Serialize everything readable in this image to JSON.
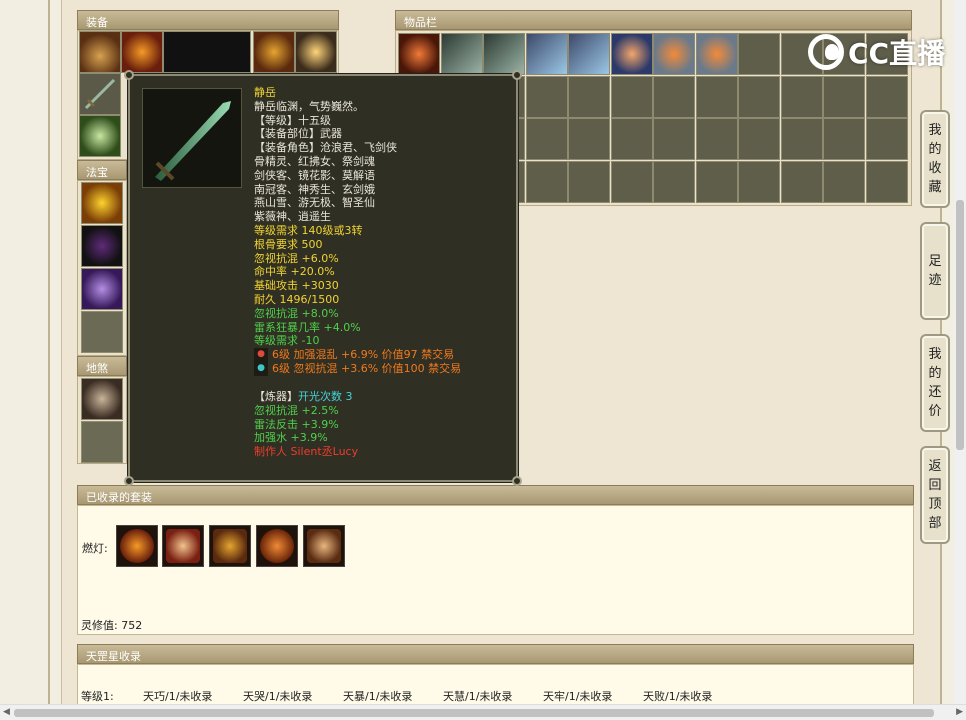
{
  "panels": {
    "equipment_title": "装备",
    "inventory_title": "物品栏",
    "fabao_title": "法宝",
    "disha_title": "地煞星",
    "collected_title": "已收录的套装",
    "tiangang_title": "天罡星收录"
  },
  "tooltip": {
    "name": "静岳",
    "desc": "静岳临渊，气势巍然。",
    "level": "【等级】十五级",
    "slot": "【装备部位】武器",
    "roles_label": "【装备角色】沧浪君、飞剑侠",
    "roles": [
      "骨精灵、红拂女、祭剑魂",
      "剑侠客、镜花影、莫解语",
      "南冠客、神秀生、玄剑娥",
      "燕山雪、游无极、智圣仙",
      "紫薇神、逍遥生"
    ],
    "req_level": "等级需求 140级或3转",
    "req_bone": "根骨要求 500",
    "stat1": "忽视抗混 +6.0%",
    "stat2": "命中率 +20.0%",
    "stat3": "基础攻击 +3030",
    "durability": "耐久 1496/1500",
    "green1": "忽视抗混 +8.0%",
    "green2": "雷系狂暴几率 +4.0%",
    "green3": "等级需求 -10",
    "gem1": "6级 加强混乱 +6.9% 价值97 禁交易",
    "gem2": "6级 忽视抗混 +3.6% 价值100 禁交易",
    "refine_label": "【炼器】",
    "refine_value": "开光次数 3",
    "refine1": "忽视抗混 +2.5%",
    "refine2": "雷法反击 +3.9%",
    "refine3": "加强水 +3.9%",
    "maker": "制作人 Silent丞Lucy"
  },
  "collected": {
    "ranking_label": "燃灯:",
    "spirit_label": "灵修值: 752"
  },
  "tiangang": {
    "level_label": "等级1:",
    "items": [
      "天巧/1/未收录",
      "天哭/1/未收录",
      "天暴/1/未收录",
      "天慧/1/未收录",
      "天牢/1/未收录",
      "天败/1/未收录"
    ]
  },
  "side_buttons": {
    "favorites": "我的收藏",
    "footprints": "足迹",
    "bargain": "我的还价",
    "top": "返回顶部"
  },
  "logo_text": "CC直播"
}
